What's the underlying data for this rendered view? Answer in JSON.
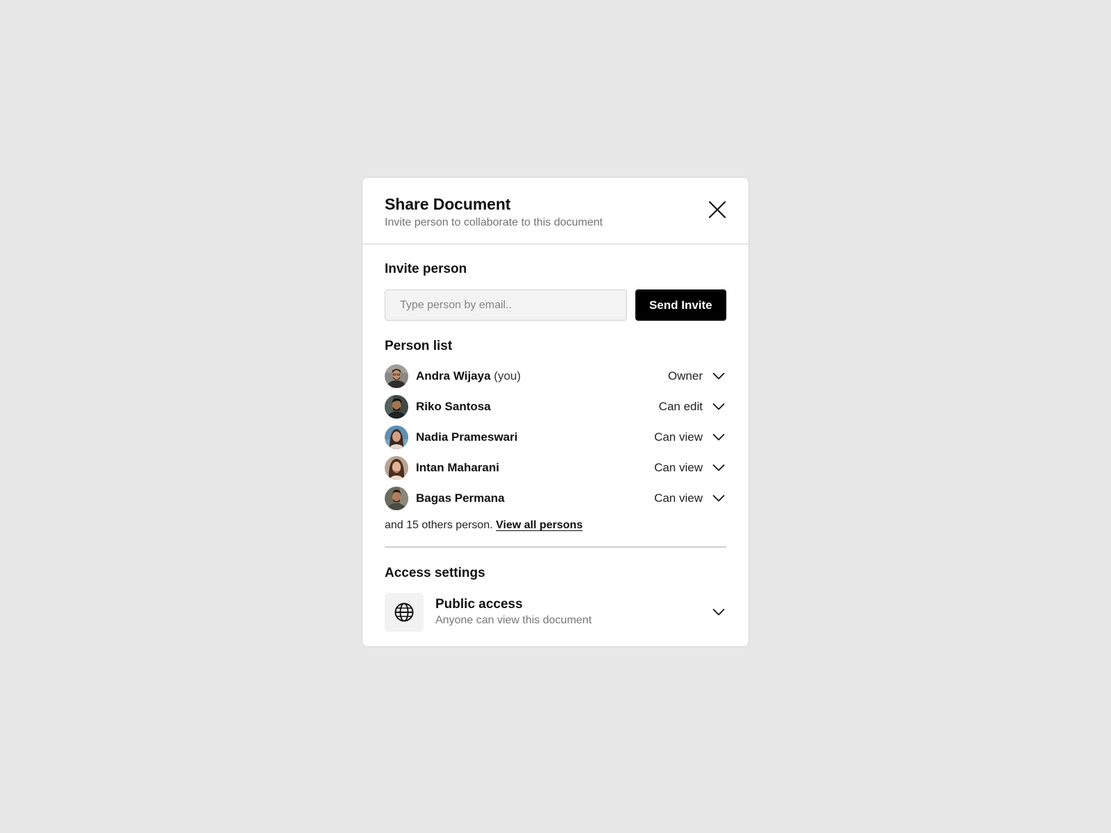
{
  "modal": {
    "title": "Share Document",
    "subtitle": "Invite person to collaborate to this document"
  },
  "invite": {
    "heading": "Invite person",
    "placeholder": "Type person by email..",
    "value": "",
    "button_label": "Send Invite"
  },
  "person_list": {
    "heading": "Person list",
    "persons": [
      {
        "name": "Andra Wijaya",
        "suffix": "(you)",
        "role": "Owner"
      },
      {
        "name": "Riko Santosa",
        "suffix": "",
        "role": "Can edit"
      },
      {
        "name": "Nadia Prameswari",
        "suffix": "",
        "role": "Can view"
      },
      {
        "name": "Intan Maharani",
        "suffix": "",
        "role": "Can view"
      },
      {
        "name": "Bagas Permana",
        "suffix": "",
        "role": "Can view"
      }
    ],
    "others_text": "and 15 others person.",
    "view_all_label": "View all persons"
  },
  "access": {
    "heading": "Access settings",
    "title": "Public access",
    "description": "Anyone can view this document",
    "icon": "globe-icon"
  },
  "icons": {
    "close": "close-icon",
    "dropdown": "chevron-down-icon"
  },
  "colors": {
    "background": "#e7e7e7",
    "primary_button": "#000000",
    "input_background": "#f3f3f3"
  }
}
